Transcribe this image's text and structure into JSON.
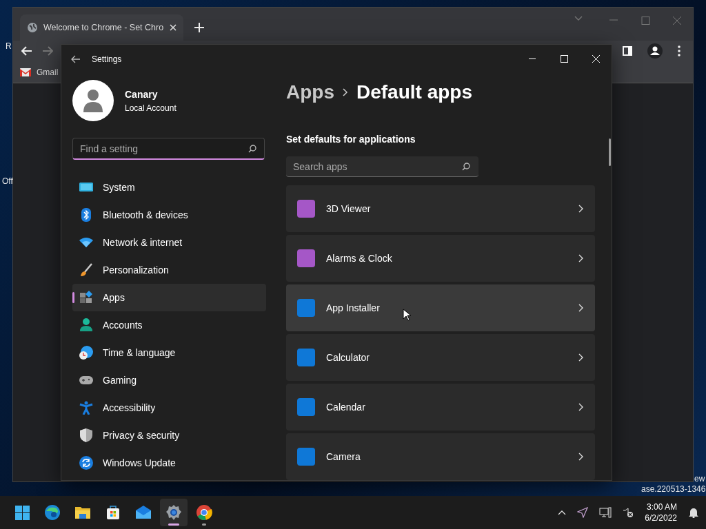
{
  "desktop": {
    "icon_labels": [
      "R",
      "Off"
    ],
    "corner_text": [
      "ew",
      "ase.220513-1346"
    ]
  },
  "browser": {
    "tabs": [
      {
        "title": "Welcome to Chrome - Set Chro",
        "selected": true
      }
    ],
    "bookmarks": [
      "Gmail"
    ]
  },
  "settings": {
    "title": "Settings",
    "account": {
      "name": "Canary",
      "type": "Local Account"
    },
    "search": {
      "placeholder": "Find a setting",
      "focused": true
    },
    "nav": [
      {
        "label": "System",
        "selected": false
      },
      {
        "label": "Bluetooth & devices",
        "selected": false
      },
      {
        "label": "Network & internet",
        "selected": false
      },
      {
        "label": "Personalization",
        "selected": false
      },
      {
        "label": "Apps",
        "selected": true
      },
      {
        "label": "Accounts",
        "selected": false
      },
      {
        "label": "Time & language",
        "selected": false
      },
      {
        "label": "Gaming",
        "selected": false
      },
      {
        "label": "Accessibility",
        "selected": false
      },
      {
        "label": "Privacy & security",
        "selected": false
      },
      {
        "label": "Windows Update",
        "selected": false
      }
    ],
    "breadcrumb": {
      "parent": "Apps",
      "current": "Default apps"
    },
    "section": "Set defaults for applications",
    "app_search": {
      "placeholder": "Search apps"
    },
    "apps": [
      {
        "name": "3D Viewer",
        "color": "#a557c7",
        "hovered": false
      },
      {
        "name": "Alarms & Clock",
        "color": "#a557c7",
        "hovered": false
      },
      {
        "name": "App Installer",
        "color": "#0f78d7",
        "hovered": true
      },
      {
        "name": "Calculator",
        "color": "#0f78d7",
        "hovered": false
      },
      {
        "name": "Calendar",
        "color": "#0f78d7",
        "hovered": false
      },
      {
        "name": "Camera",
        "color": "#0f78d7",
        "hovered": false
      }
    ]
  },
  "taskbar": {
    "apps": [
      {
        "selected": false,
        "running": false
      },
      {
        "selected": false,
        "running": false
      },
      {
        "selected": false,
        "running": false
      },
      {
        "selected": false,
        "running": false
      },
      {
        "selected": false,
        "running": false
      },
      {
        "selected": true,
        "running": true
      },
      {
        "selected": false,
        "running": true
      }
    ],
    "clock": {
      "time": "3:00 AM",
      "date": "6/2/2022"
    }
  }
}
